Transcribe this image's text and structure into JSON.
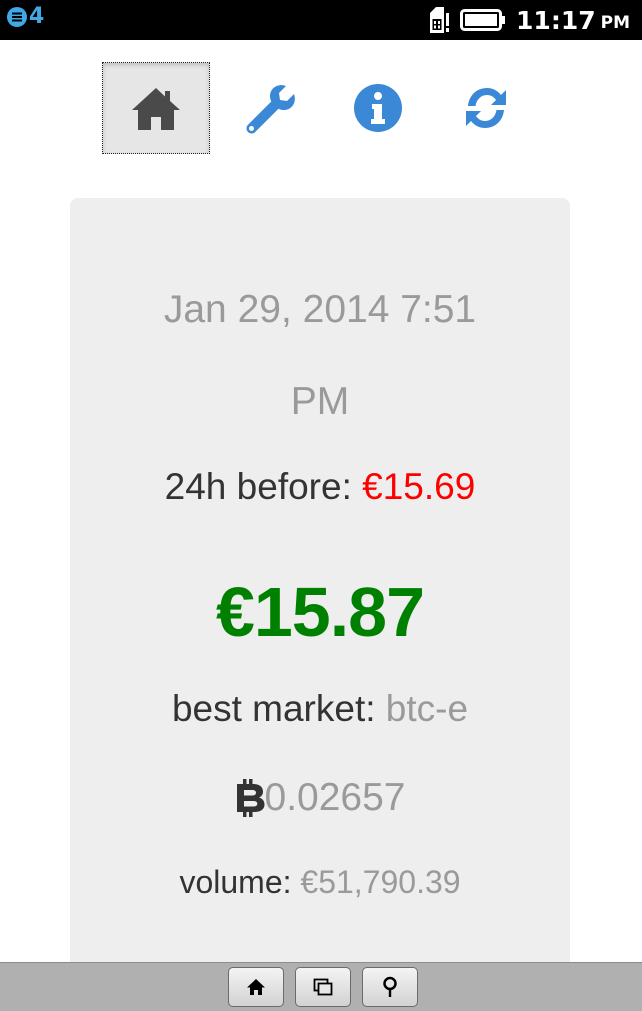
{
  "status_bar": {
    "notification_count": "4",
    "time": "11:17",
    "ampm": "PM",
    "icons": [
      "notification-icon",
      "sim-alert-icon",
      "battery-icon"
    ]
  },
  "toolbar": {
    "buttons": [
      {
        "name": "home",
        "icon": "home-icon",
        "active": true,
        "color": "#4a4a4a"
      },
      {
        "name": "settings",
        "icon": "wrench-icon",
        "active": false,
        "color": "#3b88d6"
      },
      {
        "name": "info",
        "icon": "info-icon",
        "active": false,
        "color": "#3b88d6"
      },
      {
        "name": "refresh",
        "icon": "refresh-icon",
        "active": false,
        "color": "#3b88d6"
      }
    ]
  },
  "ticker": {
    "date_line1": "Jan 29, 2014 7:51",
    "date_line2": "PM",
    "before_label": "24h before:",
    "before_value": "€15.69",
    "price": "€15.87",
    "market_label": "best market:",
    "market_value": "btc-e",
    "btc_value": "0.02657",
    "volume_label": "volume:",
    "volume_value": "€51,790.39"
  },
  "colors": {
    "price_up": "#008000",
    "before_red": "#ff0000",
    "accent_blue": "#3b88d6",
    "muted": "#9a9a9a"
  },
  "bottom_bar": {
    "buttons": [
      {
        "name": "home",
        "icon": "home-icon"
      },
      {
        "name": "windows",
        "icon": "windows-icon"
      },
      {
        "name": "location",
        "icon": "location-pin-icon"
      }
    ]
  }
}
